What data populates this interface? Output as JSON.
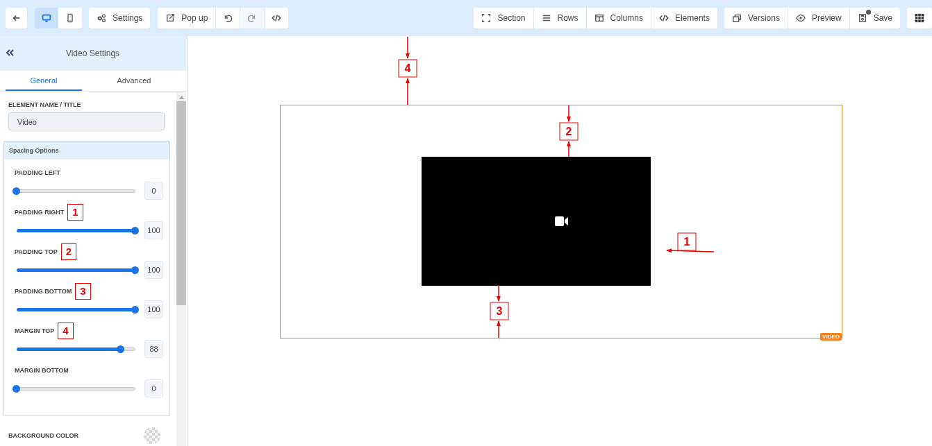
{
  "toolbar": {
    "left": [
      {
        "kind": "icon",
        "disabled": false
      },
      {
        "kind": "device",
        "selected": true
      },
      {
        "kind": "device",
        "selected": false
      },
      {
        "kind": "button",
        "label": "Settings",
        "disabled": false
      },
      {
        "kind": "button",
        "label": "Pop up",
        "disabled": false
      },
      {
        "kind": "icon",
        "disabled": false
      },
      {
        "kind": "icon",
        "disabled": true
      },
      {
        "kind": "icon",
        "disabled": false
      }
    ],
    "right_groups": [
      [
        {
          "label": "Section"
        },
        {
          "label": "Rows"
        },
        {
          "label": "Columns"
        },
        {
          "label": "Elements"
        }
      ],
      [
        {
          "label": "Versions"
        },
        {
          "label": "Preview"
        },
        {
          "label": "Save",
          "dot": true
        }
      ]
    ]
  },
  "sidebar": {
    "title": "Video Settings",
    "tabs": [
      {
        "label": "General",
        "selected": true
      },
      {
        "label": "Advanced",
        "selected": false
      }
    ],
    "name_field": {
      "label": "ELEMENT NAME / TITLE",
      "value": "Video"
    },
    "spacing": {
      "title": "Spacing Options",
      "sliders": [
        {
          "label": "PADDING LEFT",
          "level": 0,
          "value": "0"
        },
        {
          "label": "PADDING RIGHT",
          "badge": "1",
          "level": 1,
          "value": "100"
        },
        {
          "label": "PADDING TOP",
          "badge": "2",
          "level": 1,
          "value": "100"
        },
        {
          "label": "PADDING BOTTOM",
          "badge": "3",
          "level": 1,
          "value": "100"
        },
        {
          "label": "MARGIN TOP",
          "badge": "4",
          "level": 0.88,
          "value": "88"
        },
        {
          "label": "MARGIN BOTTOM",
          "level": 0,
          "value": "0"
        }
      ]
    },
    "background": {
      "label": "BACKGROUND COLOR"
    }
  },
  "canvas": {
    "element_tag": "VIDEO",
    "callouts": [
      {
        "label": "4"
      },
      {
        "label": "2"
      },
      {
        "label": "1"
      },
      {
        "label": "3"
      }
    ]
  }
}
